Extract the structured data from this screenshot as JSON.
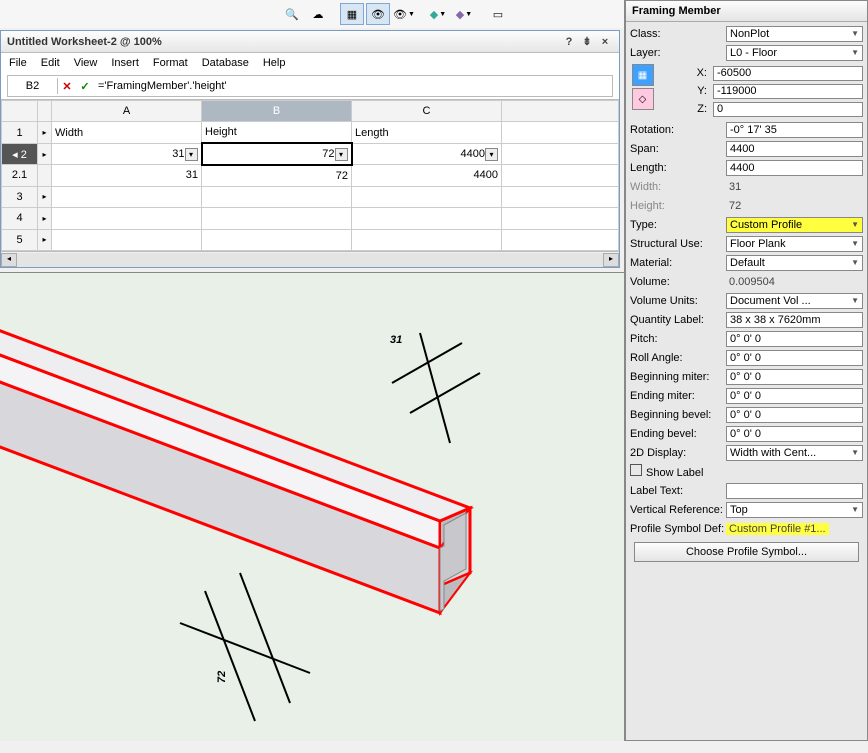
{
  "window": {
    "title": "Untitled Worksheet-2 @ 100%"
  },
  "menu": [
    "File",
    "Edit",
    "View",
    "Insert",
    "Format",
    "Database",
    "Help"
  ],
  "formula": {
    "cell_ref": "B2",
    "text": "='FramingMember'.'height'"
  },
  "grid": {
    "cols": [
      "A",
      "B",
      "C"
    ],
    "headers": {
      "A": "Width",
      "B": "Height",
      "C": "Length"
    },
    "rows": [
      {
        "n": "1",
        "A": "Width",
        "B": "Height",
        "C": "Length"
      },
      {
        "n": "2",
        "A": "31",
        "B": "72",
        "C": "4400",
        "dd": true,
        "selrow": true
      },
      {
        "n": "2.1",
        "A": "31",
        "B": "72",
        "C": "4400"
      },
      {
        "n": "3"
      },
      {
        "n": "4"
      },
      {
        "n": "5"
      }
    ],
    "scroll_right_end": true,
    "selected_col": "B",
    "selected_cell": "B2"
  },
  "dims": {
    "width_label": "31",
    "height_label": "72"
  },
  "inspector": {
    "title": "Framing Member",
    "class": "NonPlot",
    "layer": "L0 - Floor",
    "coords": {
      "X": "-60500",
      "Y": "-119000",
      "Z": "0"
    },
    "props": [
      {
        "k": "Rotation:",
        "v": "-0° 17' 35\"",
        "t": "input"
      },
      {
        "k": "Span:",
        "v": "4400",
        "t": "input"
      },
      {
        "k": "Length:",
        "v": "4400",
        "t": "input"
      },
      {
        "k": "Width:",
        "v": "31",
        "t": "ro",
        "muted": true
      },
      {
        "k": "Height:",
        "v": "72",
        "t": "ro",
        "muted": true
      },
      {
        "k": "Type:",
        "v": "Custom Profile",
        "t": "sel",
        "hi": true
      },
      {
        "k": "Structural Use:",
        "v": "Floor Plank",
        "t": "sel"
      },
      {
        "k": "Material:",
        "v": "Default",
        "t": "sel"
      },
      {
        "k": "Volume:",
        "v": "0.009504",
        "t": "ro"
      },
      {
        "k": "Volume Units:",
        "v": "Document Vol ...",
        "t": "sel"
      },
      {
        "k": "Quantity Label:",
        "v": "38 x 38 x 7620mm",
        "t": "input"
      },
      {
        "k": "Pitch:",
        "v": "0° 0' 0\"",
        "t": "input"
      },
      {
        "k": "Roll Angle:",
        "v": "0° 0' 0\"",
        "t": "input"
      },
      {
        "k": "Beginning miter:",
        "v": "0° 0' 0\"",
        "t": "input"
      },
      {
        "k": "Ending miter:",
        "v": "0° 0' 0\"",
        "t": "input"
      },
      {
        "k": "Beginning bevel:",
        "v": "0° 0' 0\"",
        "t": "input"
      },
      {
        "k": "Ending bevel:",
        "v": "0° 0' 0\"",
        "t": "input"
      },
      {
        "k": "2D Display:",
        "v": "Width with Cent...",
        "t": "sel"
      },
      {
        "k": "Show Label",
        "v": "",
        "t": "chk"
      },
      {
        "k": "Label Text:",
        "v": "",
        "t": "input"
      },
      {
        "k": "Vertical Reference:",
        "v": "Top",
        "t": "sel"
      },
      {
        "k": "Profile Symbol Def:",
        "v": "Custom Profile #1...",
        "t": "ro",
        "hi": true
      }
    ],
    "button": "Choose Profile Symbol..."
  }
}
